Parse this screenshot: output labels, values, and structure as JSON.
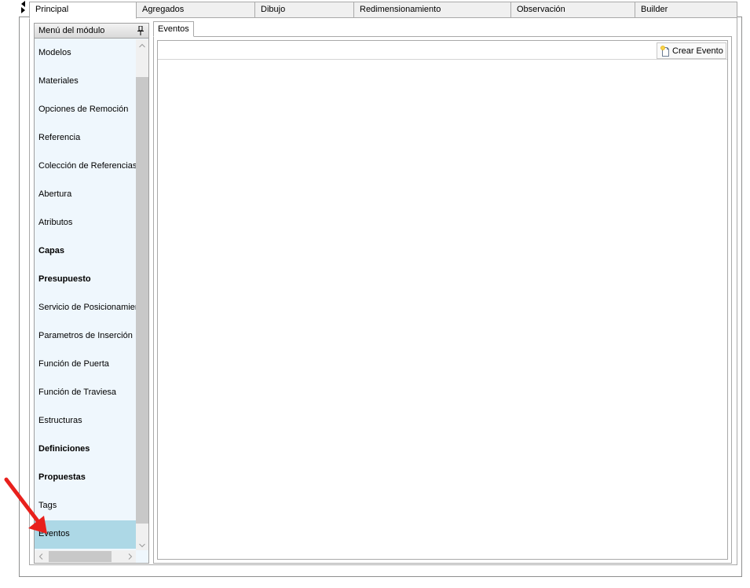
{
  "top_tabs": [
    {
      "label": "Principal",
      "active": true
    },
    {
      "label": "Agregados",
      "active": false
    },
    {
      "label": "Dibujo",
      "active": false
    },
    {
      "label": "Redimensionamiento",
      "active": false
    },
    {
      "label": "Observación",
      "active": false
    },
    {
      "label": "Builder",
      "active": false
    }
  ],
  "module_panel": {
    "title": "Menú del módulo",
    "items": [
      {
        "label": "Modelos",
        "bold": false
      },
      {
        "label": "Materiales",
        "bold": false
      },
      {
        "label": "Opciones de Remoción",
        "bold": false
      },
      {
        "label": "Referencia",
        "bold": false
      },
      {
        "label": "Colección de Referencias",
        "bold": false
      },
      {
        "label": "Abertura",
        "bold": false
      },
      {
        "label": "Atributos",
        "bold": false
      },
      {
        "label": "Capas",
        "bold": true
      },
      {
        "label": "Presupuesto",
        "bold": true
      },
      {
        "label": "Servicio de Posicionamiento",
        "bold": false
      },
      {
        "label": "Parametros de Inserción",
        "bold": false
      },
      {
        "label": "Función de Puerta",
        "bold": false
      },
      {
        "label": "Función de Traviesa",
        "bold": false
      },
      {
        "label": "Estructuras",
        "bold": false
      },
      {
        "label": "Definiciones",
        "bold": true
      },
      {
        "label": "Propuestas",
        "bold": true
      },
      {
        "label": "Tags",
        "bold": false
      },
      {
        "label": "Eventos",
        "bold": false,
        "selected": true
      }
    ]
  },
  "events": {
    "tab_label": "Eventos",
    "create_button_label": "Crear Evento"
  },
  "colors": {
    "selected_item": "#add8e6",
    "panel_background": "#eff7fd",
    "annotation_arrow": "#e8201c"
  },
  "icons": {
    "pin": "pin-icon",
    "new_document": "new-document-icon",
    "annotation": "red-arrow-icon"
  }
}
